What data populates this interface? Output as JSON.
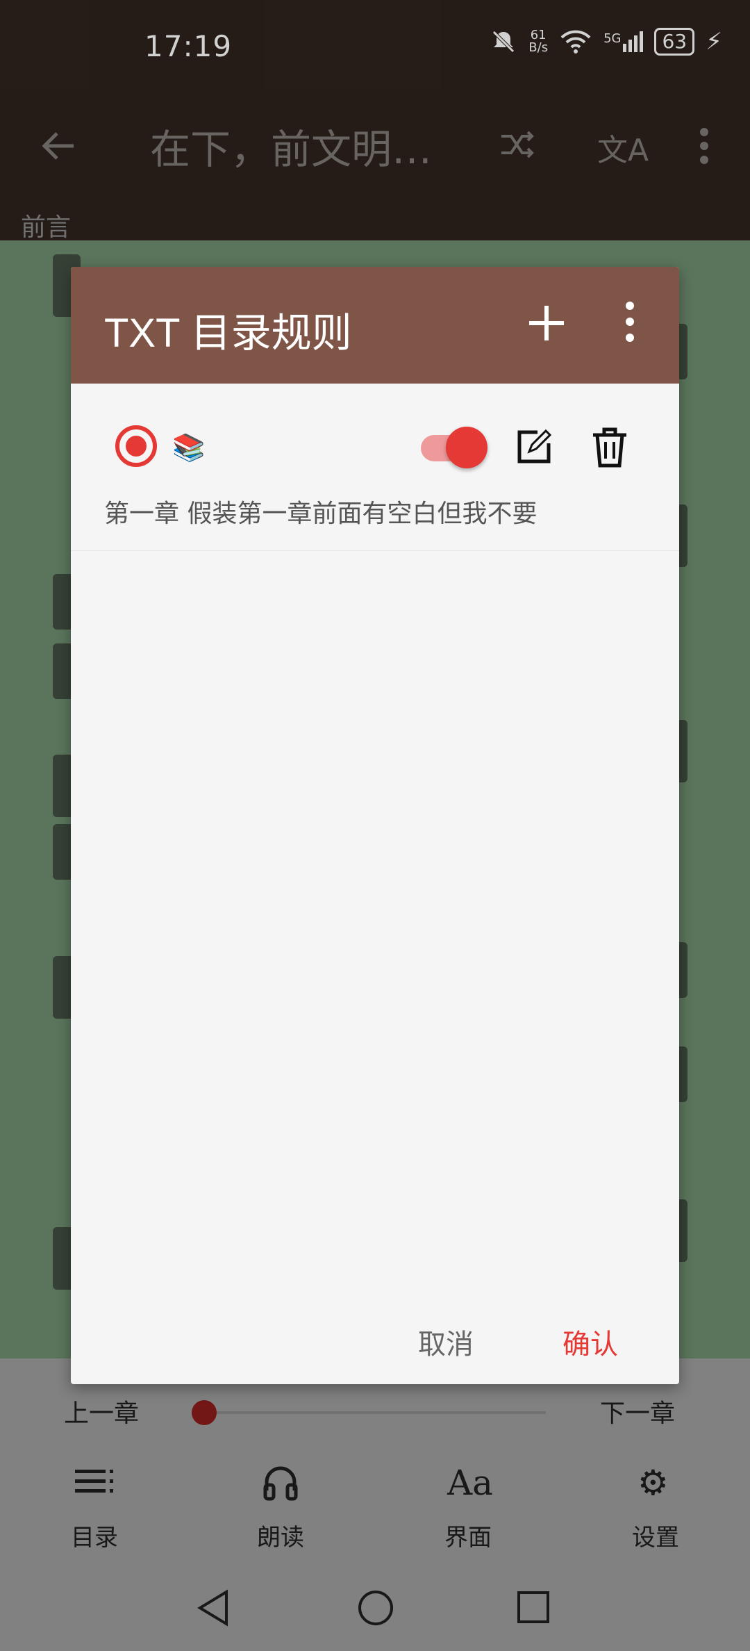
{
  "status_bar": {
    "time": "17:19",
    "net_speed_top": "61",
    "net_speed_bottom": "B/s",
    "signal_label": "5G",
    "battery": "63"
  },
  "app_bar": {
    "title": "在下，前文明…"
  },
  "reader": {
    "section_label": "前言"
  },
  "dialog": {
    "title": "TXT 目录规则",
    "rules": [
      {
        "name": "第一章 假装第一章前面有空白但我不要",
        "enabled": true,
        "selected": true
      }
    ],
    "cancel_label": "取消",
    "confirm_label": "确认"
  },
  "reader_controls": {
    "prev_chapter": "上一章",
    "next_chapter": "下一章",
    "progress": 0.0,
    "tabs": [
      {
        "label": "目录",
        "icon": "toc-icon"
      },
      {
        "label": "朗读",
        "icon": "headphones-icon"
      },
      {
        "label": "界面",
        "icon": "font-icon"
      },
      {
        "label": "设置",
        "icon": "gear-icon"
      }
    ]
  },
  "colors": {
    "accent": "#e53935",
    "dialog_header": "#7e5547",
    "reader_bg": "#6f8f71"
  }
}
